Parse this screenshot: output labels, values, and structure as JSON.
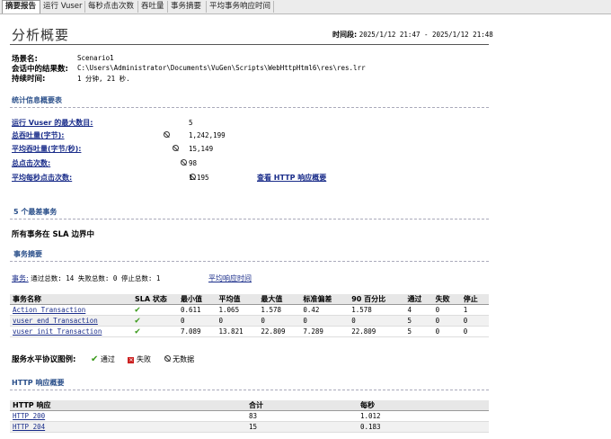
{
  "tabs": [
    "摘要报告",
    "运行 Vuser",
    "每秒点击次数",
    "吞吐量",
    "事务摘要",
    "平均事务响应时间"
  ],
  "page_title": "分析概要",
  "period": {
    "label": "时间段:",
    "value": "2025/1/12 21:47 - 2025/1/12 21:48"
  },
  "info": {
    "scenario_label": "场景名:",
    "scenario_value": "Scenario1",
    "result_label": "会话中的结果数:",
    "result_value": "C:\\Users\\Administrator\\Documents\\VuGen\\Scripts\\WebHttpHtml6\\res\\res.lrr",
    "duration_label": "持续时间:",
    "duration_value": "1 分钟, 21 秒."
  },
  "stats": {
    "heading": "统计信息概要表",
    "rows": [
      {
        "label": "运行 Vuser 的最大数目:",
        "value": "5"
      },
      {
        "label": "总吞吐量(字节):",
        "value": "1,242,199"
      },
      {
        "label": "平均吞吐量(字节/秒):",
        "value": "15,149"
      },
      {
        "label": "总点击次数:",
        "value": "98"
      },
      {
        "label": "平均每秒点击次数:",
        "value": "1.195"
      }
    ],
    "http_link": "查看 HTTP 响应概要"
  },
  "worst": {
    "heading": "5 个最差事务",
    "sla_note": "所有事务在 SLA 边界中"
  },
  "tx_summary": {
    "heading": "事务摘要",
    "line_label": "事务:",
    "line_value": "通过总数: 14 失败总数: 0 停止总数: 1",
    "avg_link": "平均响应时间",
    "columns": [
      "事务名称",
      "SLA 状态",
      "最小值",
      "平均值",
      "最大值",
      "标准偏差",
      "90 百分比",
      "通过",
      "失败",
      "停止"
    ],
    "rows": [
      [
        "Action_Transaction",
        "",
        "0.611",
        "1.065",
        "1.578",
        "0.42",
        "1.578",
        "4",
        "0",
        "1"
      ],
      [
        "vuser_end_Transaction",
        "",
        "0",
        "0",
        "0",
        "0",
        "0",
        "5",
        "0",
        "0"
      ],
      [
        "vuser_init_Transaction",
        "",
        "7.089",
        "13.821",
        "22.809",
        "7.289",
        "22.809",
        "5",
        "0",
        "0"
      ]
    ]
  },
  "legend": {
    "label": "服务水平协议图例:",
    "pass": "通过",
    "fail": "失败",
    "nodata": "无数据"
  },
  "http": {
    "heading": "HTTP 响应概要",
    "columns": [
      "HTTP 响应",
      "合计",
      "每秒"
    ],
    "rows": [
      [
        "HTTP_200",
        "83",
        "1.012"
      ],
      [
        "HTTP_204",
        "15",
        "0.183"
      ]
    ]
  }
}
